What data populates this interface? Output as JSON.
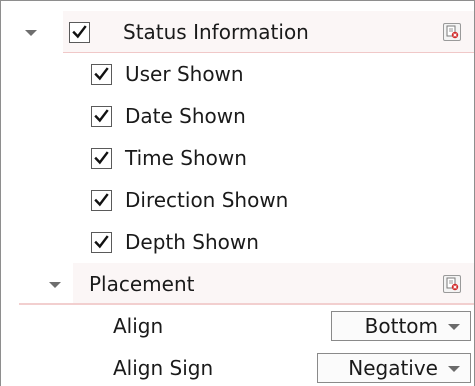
{
  "status_group": {
    "label": "Status Information",
    "checked": true,
    "expanded": true,
    "reset_icon": "reset-defaults-icon"
  },
  "status_items": [
    {
      "label": "User Shown",
      "checked": true
    },
    {
      "label": "Date Shown",
      "checked": true
    },
    {
      "label": "Time Shown",
      "checked": true
    },
    {
      "label": "Direction Shown",
      "checked": true
    },
    {
      "label": "Depth Shown",
      "checked": true
    }
  ],
  "placement_group": {
    "label": "Placement",
    "expanded": true,
    "reset_icon": "reset-defaults-icon"
  },
  "placement_props": {
    "align": {
      "label": "Align",
      "value": "Bottom"
    },
    "align_sign": {
      "label": "Align Sign",
      "value": "Negative"
    }
  },
  "colors": {
    "group_underline": "#f0c8c8",
    "frame_border": "#8e8e8e"
  }
}
